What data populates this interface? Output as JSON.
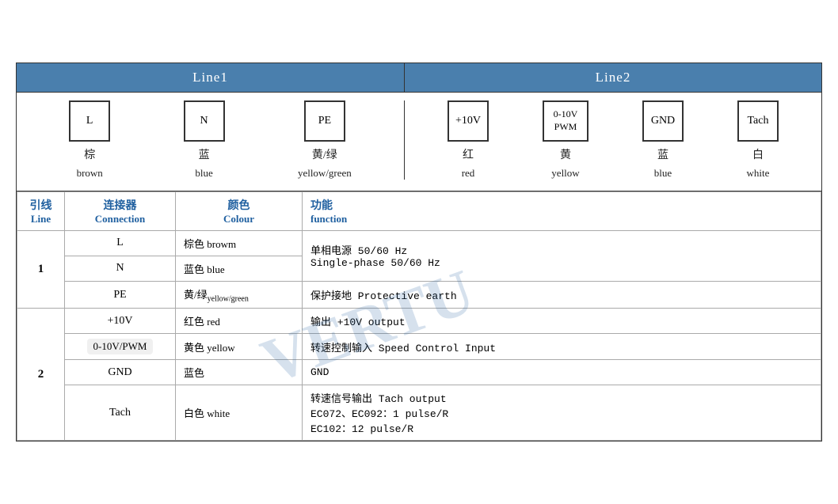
{
  "header": {
    "line1_label": "Line1",
    "line2_label": "Line2"
  },
  "line1_connectors": [
    {
      "symbol": "L",
      "cn": "棕",
      "en": "brown"
    },
    {
      "symbol": "N",
      "cn": "蓝",
      "en": "blue"
    },
    {
      "symbol": "PE",
      "cn": "黄/绿",
      "en": "yellow/green"
    }
  ],
  "line2_connectors": [
    {
      "symbol": "+10V",
      "cn": "红",
      "en": "red"
    },
    {
      "symbol": "0-10V\nPWM",
      "cn": "黄",
      "en": "yellow"
    },
    {
      "symbol": "GND",
      "cn": "蓝",
      "en": "blue"
    },
    {
      "symbol": "Tach",
      "cn": "白",
      "en": "white"
    }
  ],
  "table": {
    "headers": {
      "line_cn": "引线",
      "line_en": "Line",
      "connection_cn": "连接器",
      "connection_en": "Connection",
      "colour_cn": "颜色",
      "colour_en": "Colour",
      "function_cn": "功能",
      "function_en": "function"
    },
    "rows": [
      {
        "line": "1",
        "line_rowspan": 3,
        "entries": [
          {
            "conn": "L",
            "colour_cn": "棕色",
            "colour_en": "browm",
            "function": "单相电源 50/60 Hz\nSingle-phase 50/60 Hz",
            "rowspan": 2
          },
          {
            "conn": "N",
            "colour_cn": "蓝色",
            "colour_en": "blue",
            "function": null
          },
          {
            "conn": "PE",
            "colour_cn": "黄/绿",
            "colour_en": "yellow/green",
            "colour_en_sub": true,
            "function": "保护接地 Protective earth"
          }
        ]
      },
      {
        "line": "2",
        "line_rowspan": 4,
        "entries": [
          {
            "conn": "+10V",
            "colour_cn": "红色",
            "colour_en": "red",
            "function": "输出 +10V output"
          },
          {
            "conn": "0-10V/PWM",
            "rounded": true,
            "colour_cn": "黄色",
            "colour_en": "yellow",
            "function": "转速控制输入 Speed Control Input"
          },
          {
            "conn": "GND",
            "colour_cn": "蓝色",
            "colour_en": "",
            "function": "GND"
          },
          {
            "conn": "Tach",
            "colour_cn": "白色",
            "colour_en": "white",
            "function": "转速信号输出 Tach output\nEC072、EC092：1 pulse/R\nEC102：12 pulse/R"
          }
        ]
      }
    ]
  }
}
